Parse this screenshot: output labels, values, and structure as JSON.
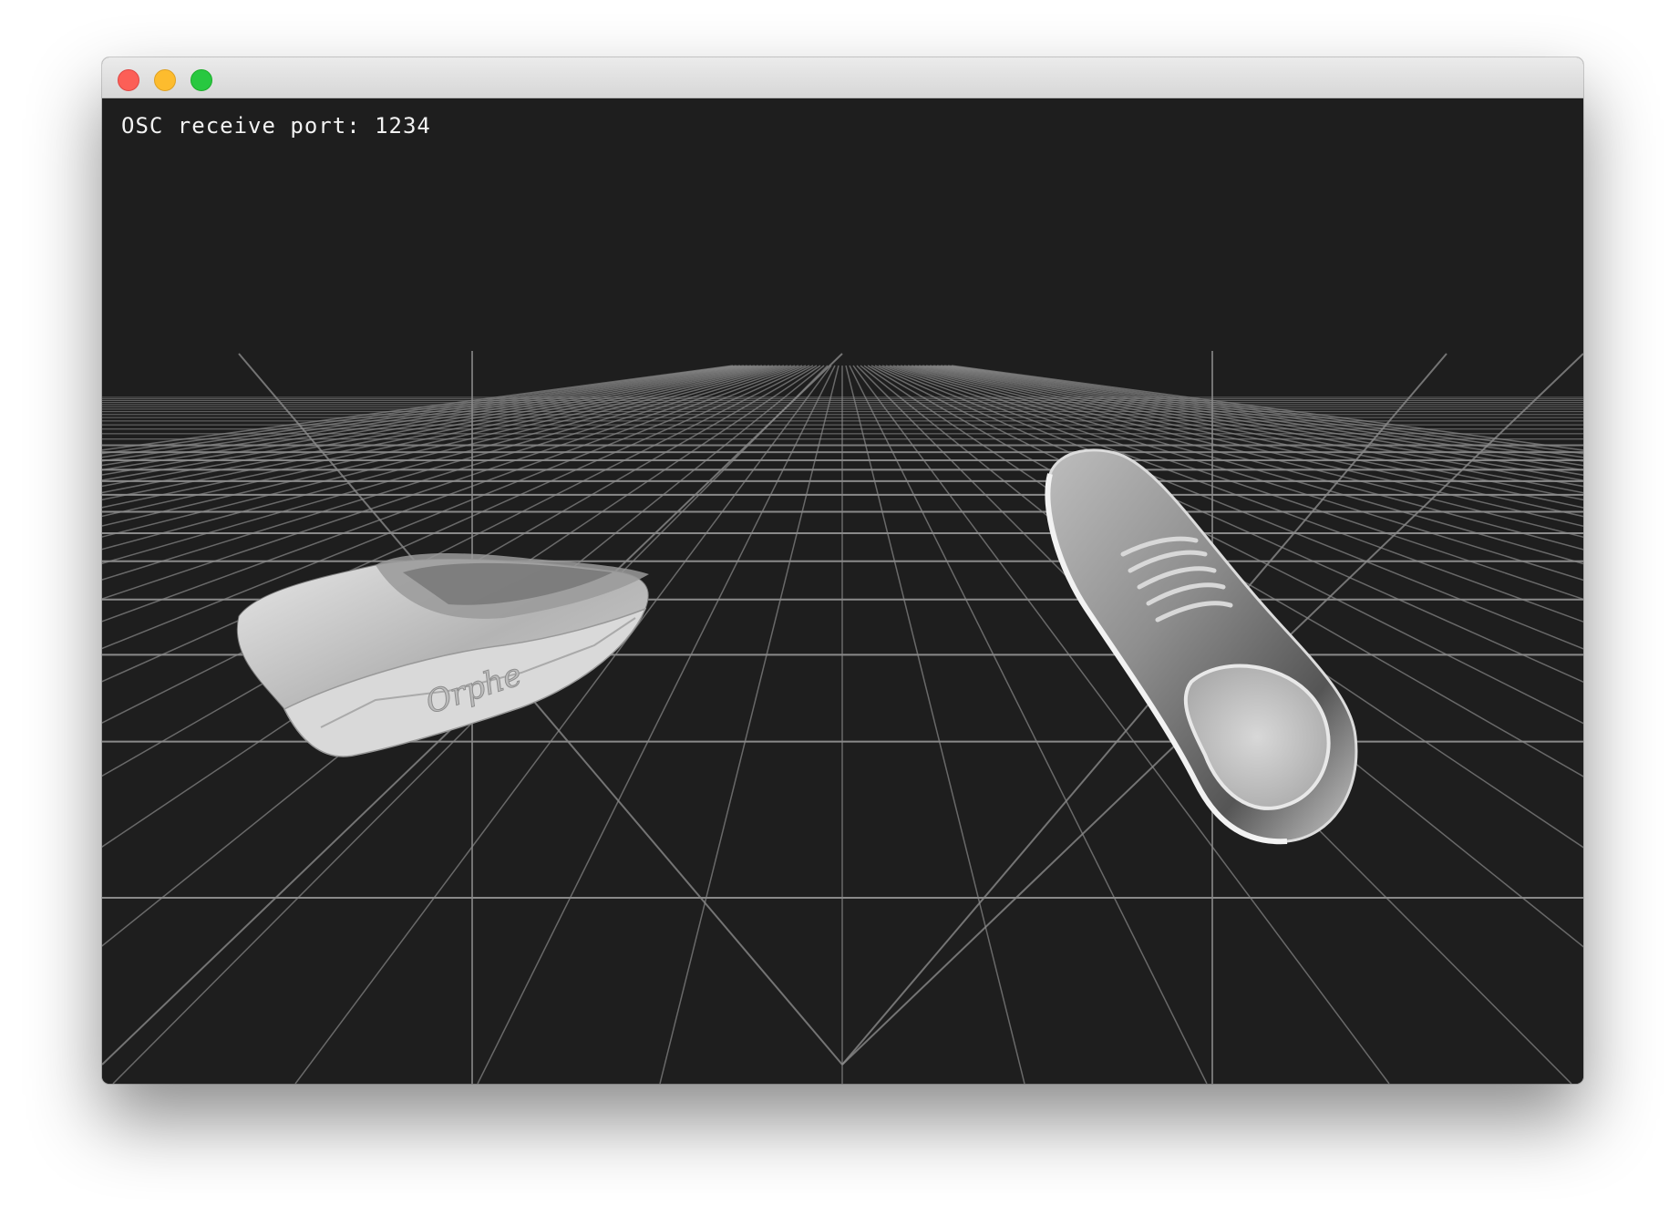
{
  "window": {
    "controls": [
      {
        "name": "close-button",
        "color": "#fc5f57"
      },
      {
        "name": "minimize-button",
        "color": "#fdbc2e"
      },
      {
        "name": "zoom-button",
        "color": "#28c840"
      }
    ]
  },
  "viewport": {
    "osc_label": "OSC receive port: 1234",
    "background_color": "#1e1e1e",
    "grid_color": "#8a8a8a",
    "models": [
      {
        "name": "left-shoe-model",
        "sole_text": "Orphe"
      },
      {
        "name": "right-shoe-model"
      }
    ]
  }
}
